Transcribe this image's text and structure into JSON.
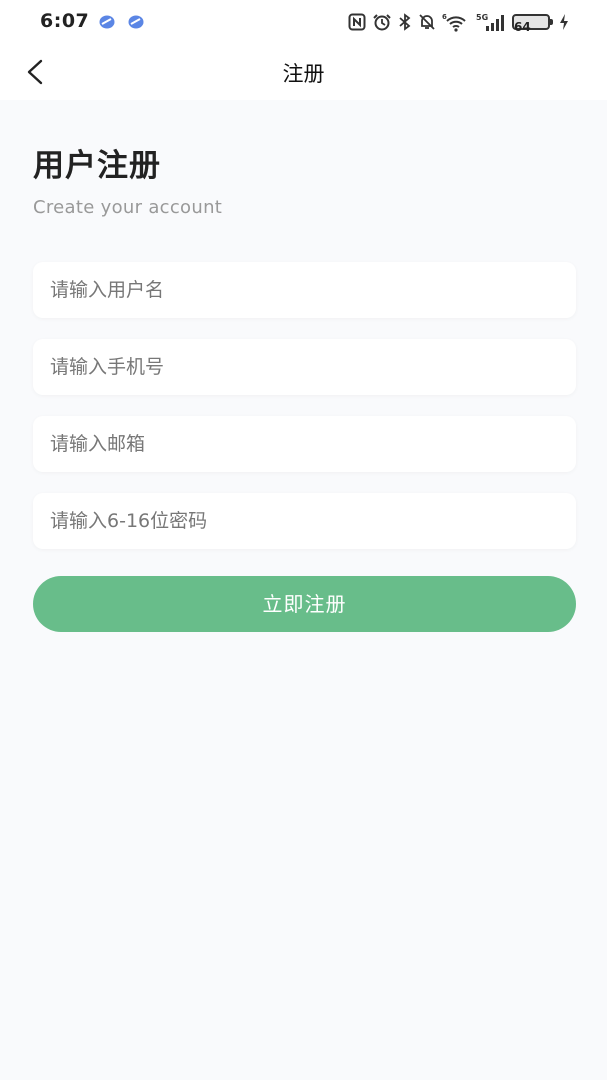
{
  "status_bar": {
    "time": "6:07",
    "battery": "64",
    "network": "5G",
    "wifi_badge": "6",
    "icons": [
      "nfc-icon",
      "alarm-icon",
      "bluetooth-icon",
      "mute-icon",
      "wifi-icon",
      "signal-icon",
      "battery-icon",
      "charging-icon"
    ]
  },
  "nav": {
    "title": "注册",
    "back_icon": "back-arrow-icon"
  },
  "header": {
    "title": "用户注册",
    "subtitle": "Create your account"
  },
  "form": {
    "username_placeholder": "请输入用户名",
    "phone_placeholder": "请输入手机号",
    "email_placeholder": "请输入邮箱",
    "password_placeholder": "请输入6-16位密码",
    "submit_label": "立即注册"
  },
  "colors": {
    "accent": "#68bd8a",
    "background": "#f9fafc"
  }
}
